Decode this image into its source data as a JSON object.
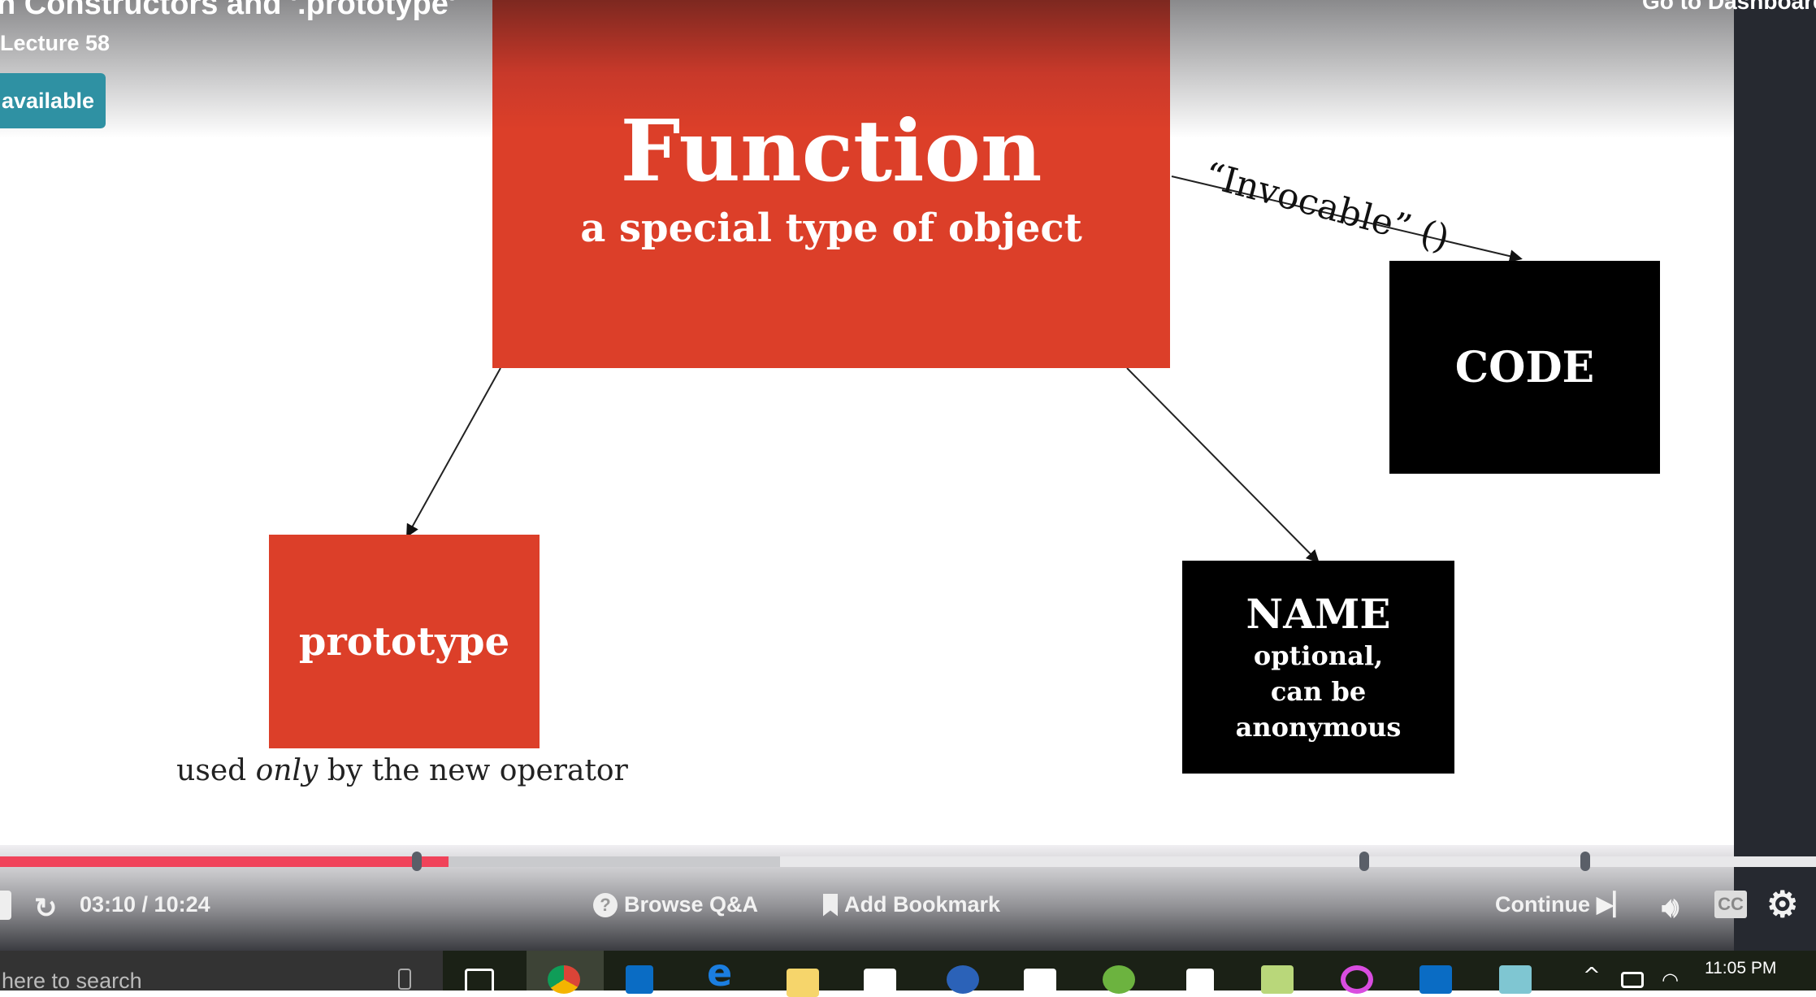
{
  "header": {
    "course_title": "n Constructors and '.prototype'",
    "lecture": "Lecture 58",
    "available_button": "available",
    "dashboard_link": "Go to Dashboard"
  },
  "slide": {
    "function_title": "Function",
    "function_subtitle": "a special type of object",
    "invocable_label": "“Invocable” ()",
    "code_box": "CODE",
    "name_box": {
      "title": "NAME",
      "lines": [
        "optional,",
        "can be",
        "anonymous"
      ]
    },
    "prototype_box": "prototype",
    "caption": {
      "before": "used ",
      "emph": "only",
      "after": " by the new operator"
    },
    "colors": {
      "red": "#dc3f29",
      "black": "#000000"
    }
  },
  "player": {
    "progress_percent": 30.4,
    "buffered_percent": 52.9,
    "elapsed": "03:10",
    "duration": "10:24",
    "time_display": "03:10 / 10:24",
    "browse_qa": "Browse Q&A",
    "add_bookmark": "Add Bookmark",
    "continue": "Continue",
    "cc": "CC",
    "accent": "#f0435a"
  },
  "taskbar": {
    "search_placeholder": "here to search",
    "clock": "11:05 PM"
  }
}
